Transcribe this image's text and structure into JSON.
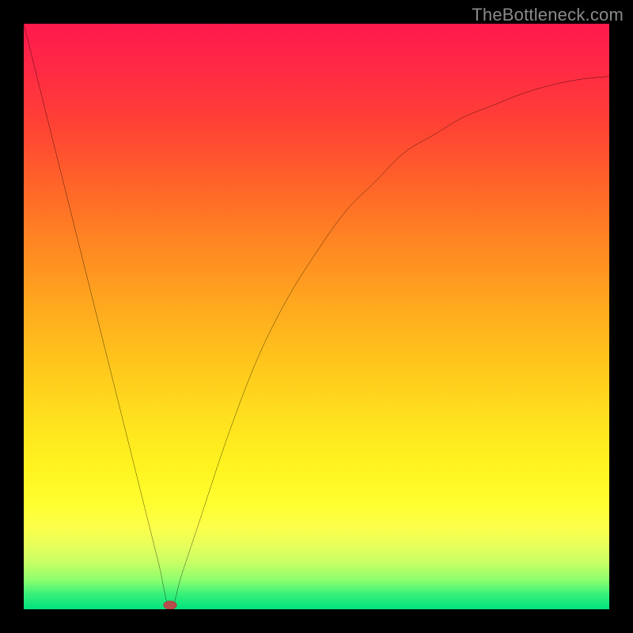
{
  "attribution": "TheBottleneck.com",
  "chart_data": {
    "type": "line",
    "title": "",
    "xlabel": "",
    "ylabel": "",
    "xlim": [
      0,
      100
    ],
    "ylim": [
      0,
      100
    ],
    "grid": false,
    "legend": false,
    "annotations": [
      {
        "name": "marker",
        "x": 25,
        "y": 0,
        "color": "#b84d4d"
      }
    ],
    "series": [
      {
        "name": "curve",
        "color": "#000000",
        "x": [
          0,
          5,
          10,
          15,
          20,
          23,
          25,
          27,
          30,
          35,
          40,
          45,
          50,
          55,
          60,
          65,
          70,
          75,
          80,
          85,
          90,
          95,
          100
        ],
        "y": [
          100,
          80,
          60,
          40,
          20,
          8,
          0,
          6,
          15,
          30,
          43,
          53,
          61,
          68,
          73,
          78,
          81,
          84,
          86,
          88,
          89.5,
          90.5,
          91
        ]
      }
    ],
    "background_gradient": {
      "direction": "top-to-bottom",
      "stops": [
        {
          "pos": 0,
          "color": "#ff1a4d"
        },
        {
          "pos": 50,
          "color": "#ffb81e"
        },
        {
          "pos": 80,
          "color": "#fffe30"
        },
        {
          "pos": 100,
          "color": "#00e27e"
        }
      ]
    }
  }
}
